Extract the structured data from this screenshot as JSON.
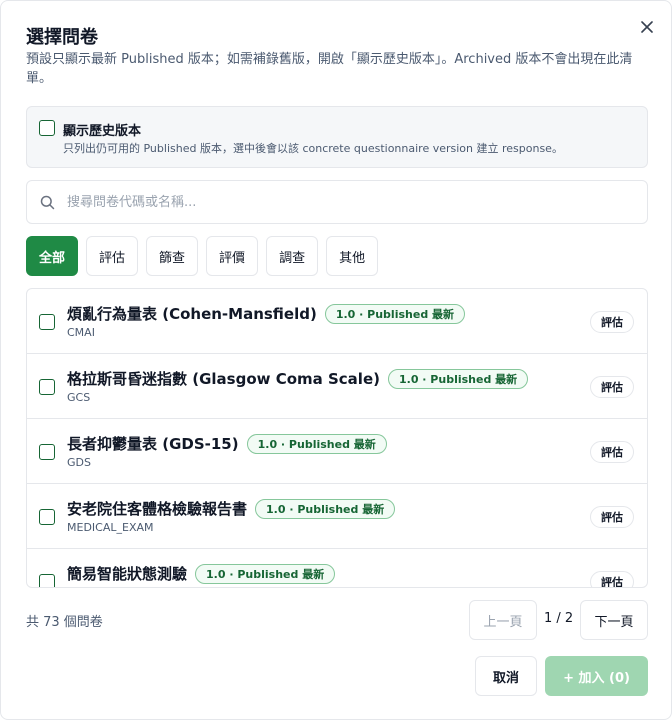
{
  "dialog": {
    "title": "選擇問卷",
    "description": "預設只顯示最新 Published 版本；如需補錄舊版，開啟「顯示歷史版本」。Archived 版本不會出現在此清單。",
    "close_icon": "close-icon"
  },
  "history": {
    "label": "顯示歷史版本",
    "sub": "只列出仍可用的 Published 版本，選中後會以該 concrete questionnaire version 建立 response。",
    "checked": false
  },
  "search": {
    "placeholder": "搜尋問卷代碼或名稱...",
    "value": "",
    "icon": "search-icon"
  },
  "filters": [
    {
      "label": "全部",
      "active": true
    },
    {
      "label": "評估",
      "active": false
    },
    {
      "label": "篩查",
      "active": false
    },
    {
      "label": "評價",
      "active": false
    },
    {
      "label": "調查",
      "active": false
    },
    {
      "label": "其他",
      "active": false
    }
  ],
  "items": [
    {
      "name": "煩亂行為量表 (Cohen-Mansfield)",
      "code": "CMAI",
      "version": "1.0 · Published 最新",
      "category": "評估"
    },
    {
      "name": "格拉斯哥昏迷指數 (Glasgow Coma Scale)",
      "code": "GCS",
      "version": "1.0 · Published 最新",
      "category": "評估"
    },
    {
      "name": "長者抑鬱量表 (GDS-15)",
      "code": "GDS",
      "version": "1.0 · Published 最新",
      "category": "評估"
    },
    {
      "name": "安老院住客體格檢驗報告書",
      "code": "MEDICAL_EXAM",
      "version": "1.0 · Published 最新",
      "category": "評估"
    },
    {
      "name": "簡易智能狀態測驗",
      "code": "",
      "version": "1.0 · Published 最新",
      "category": "評估"
    }
  ],
  "footer": {
    "count": "共 73 個問卷",
    "prev": "上一頁",
    "page": "1 / 2",
    "next": "下一頁",
    "cancel": "取消",
    "add": "+ 加入 (0)"
  },
  "colors": {
    "primary": "#1f8a45",
    "primary_disabled": "#9fd6b1",
    "badge_text": "#166534",
    "border": "#e5e7eb"
  }
}
